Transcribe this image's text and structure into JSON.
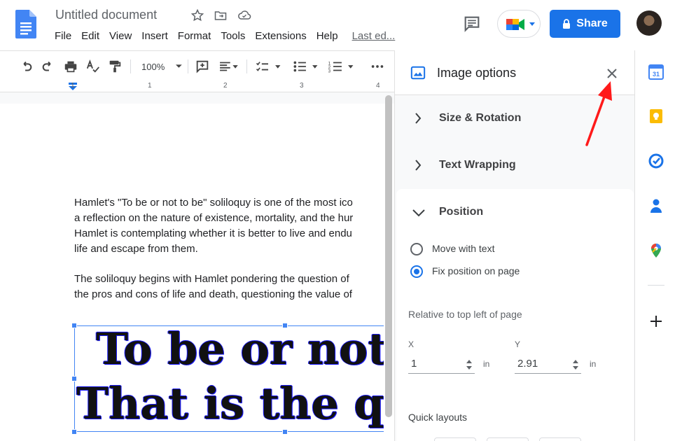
{
  "header": {
    "title": "Untitled document",
    "menu": [
      "File",
      "Edit",
      "View",
      "Insert",
      "Format",
      "Tools",
      "Extensions",
      "Help"
    ],
    "last_edit": "Last ed...",
    "share_label": "Share"
  },
  "toolbar": {
    "zoom": "100%"
  },
  "ruler": {
    "labels": [
      "1",
      "1",
      "2",
      "3",
      "4"
    ]
  },
  "document": {
    "paragraph1": [
      "Hamlet's \"To be or not to be\" soliloquy is one of the most ico",
      "a reflection on the nature of existence, mortality, and the hur",
      "Hamlet is contemplating whether it is better to live and endu",
      "life and escape from them."
    ],
    "paragraph2": [
      "The soliloquy begins with Hamlet pondering the question of",
      "the pros and cons of life and death, questioning the value of"
    ],
    "image_line1": "To be or not to",
    "image_line2": "That is the que"
  },
  "panel": {
    "title": "Image options",
    "sections": {
      "size_rotation": "Size & Rotation",
      "text_wrapping": "Text Wrapping",
      "position": "Position"
    },
    "position": {
      "option_move": "Move with text",
      "option_fix": "Fix position on page",
      "selected": "Fix position on page",
      "relative_label": "Relative to top left of page",
      "x_label": "X",
      "x_value": "1",
      "x_unit": "in",
      "y_label": "Y",
      "y_value": "2.91",
      "y_unit": "in"
    },
    "quick_layouts": "Quick layouts"
  },
  "colors": {
    "accent": "#1a73e8",
    "arrow": "#ff1a1a"
  }
}
